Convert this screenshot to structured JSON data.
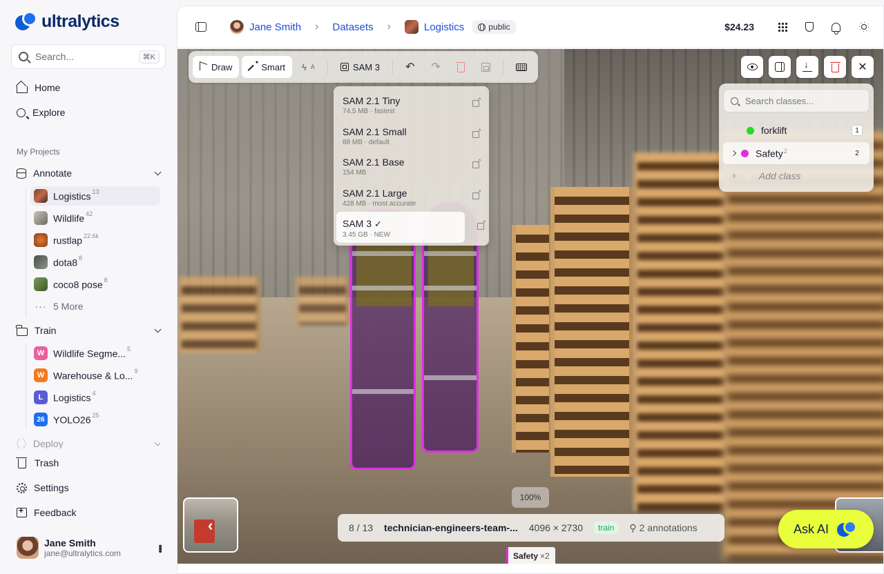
{
  "brand": {
    "name": "ultralytics"
  },
  "search": {
    "placeholder": "Search...",
    "shortcut": "⌘K"
  },
  "nav": {
    "home": "Home",
    "explore": "Explore"
  },
  "sidebar": {
    "section_label": "My Projects",
    "annotate": {
      "label": "Annotate",
      "items": [
        {
          "label": "Logistics",
          "count": "13"
        },
        {
          "label": "Wildlife",
          "count": "42"
        },
        {
          "label": "rustlap",
          "count": "22.6k"
        },
        {
          "label": "dota8",
          "count": "8"
        },
        {
          "label": "coco8 pose",
          "count": "8"
        }
      ],
      "more": "5 More"
    },
    "train": {
      "label": "Train",
      "items": [
        {
          "label": "Wildlife Segme...",
          "count": "5",
          "badge": "W",
          "color": "#ec5fa0"
        },
        {
          "label": "Warehouse & Lo...",
          "count": "9",
          "badge": "W",
          "color": "#f47a1f"
        },
        {
          "label": "Logistics",
          "count": "4",
          "badge": "L",
          "color": "#5b5bd6"
        },
        {
          "label": "YOLO26",
          "count": "25",
          "badge": "26",
          "color": "#1e6ff0"
        }
      ]
    },
    "deploy": {
      "label": "Deploy"
    },
    "trash": "Trash",
    "settings": "Settings",
    "feedback": "Feedback",
    "user": {
      "name": "Jane Smith",
      "email": "jane@ultralytics.com"
    }
  },
  "topbar": {
    "user": "Jane Smith",
    "datasets": "Datasets",
    "dataset": "Logistics",
    "visibility": "public",
    "balance": "$24.23"
  },
  "toolbar": {
    "draw": "Draw",
    "smart": "Smart",
    "auto": "A",
    "model": "SAM 3"
  },
  "models": [
    {
      "name": "SAM 2.1 Tiny",
      "meta": "74.5 MB · fastest",
      "selected": false
    },
    {
      "name": "SAM 2.1 Small",
      "meta": "88 MB · default",
      "selected": false
    },
    {
      "name": "SAM 2.1 Base",
      "meta": "154 MB",
      "selected": false
    },
    {
      "name": "SAM 2.1 Large",
      "meta": "428 MB · most accurate",
      "selected": false
    },
    {
      "name": "SAM 3",
      "meta": "3.45 GB · NEW",
      "selected": true
    }
  ],
  "classes": {
    "search_placeholder": "Search classes...",
    "items": [
      {
        "name": "forklift",
        "color": "#22dd22",
        "count": "1",
        "sup": ""
      },
      {
        "name": "Safety",
        "color": "#e02ee6",
        "count": "2",
        "sup": "2"
      }
    ],
    "add_label": "Add class"
  },
  "viewer": {
    "zoom": "100%",
    "position": "8 / 13",
    "filename": "technician-engineers-team-...",
    "dimensions": "4096 × 2730",
    "split": "train",
    "annotations": "2 annotations",
    "tag_label": "Safety",
    "tag_count": "×2"
  },
  "ask_ai": "Ask AI"
}
